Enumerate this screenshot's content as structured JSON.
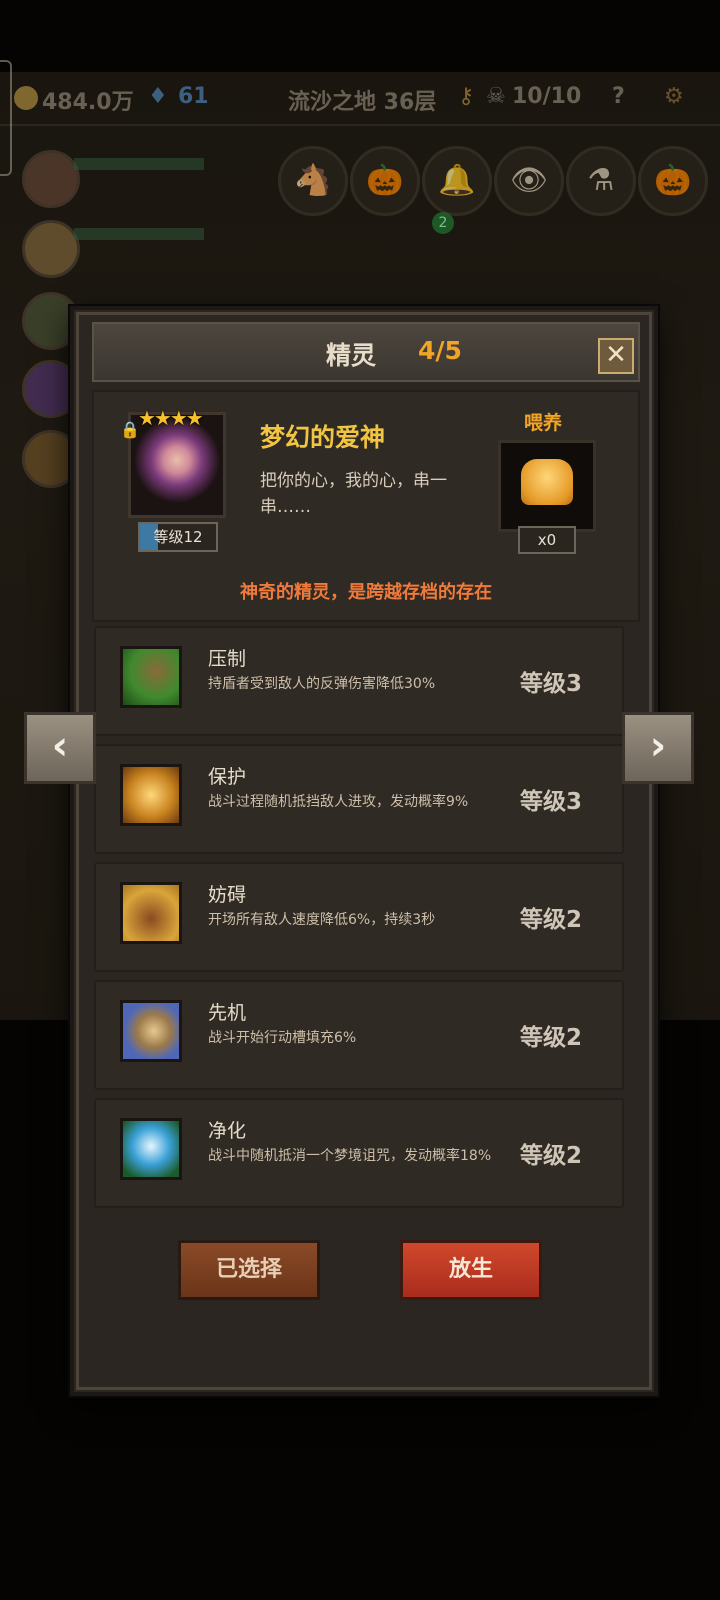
{
  "top_bar": {
    "gold": "484.0万",
    "gems": "61",
    "location": "流沙之地 36层",
    "skulls": "10/10",
    "help_icon": "?"
  },
  "background_icons": [
    "horse-icon",
    "pumpkin-icon",
    "bell-icon",
    "eye-icon",
    "potion-icon",
    "pumpkin-icon"
  ],
  "background_badge": "2",
  "dialog": {
    "title": "精灵",
    "count": "4/5",
    "close_label": "✕"
  },
  "pet": {
    "stars": "★★★★",
    "level_label": "等级12",
    "name": "梦幻的爱神",
    "description": "把你的心，我的心，串一串……",
    "feed_label": "喂养",
    "feed_count": "x0",
    "tagline": "神奇的精灵，是跨越存档的存在",
    "locked": true
  },
  "skills": [
    {
      "name": "压制",
      "desc": "持盾者受到敌人的反弹伤害降低30%",
      "level": "等级3",
      "icon": "claw-icon",
      "color": "#3f8a2e"
    },
    {
      "name": "保护",
      "desc": "战斗过程随机抵挡敌人进攻，发动概率9%",
      "level": "等级3",
      "icon": "shield-spirit-icon",
      "color": "#c98420"
    },
    {
      "name": "妨碍",
      "desc": "开场所有敌人速度降低6%，持续3秒",
      "level": "等级2",
      "icon": "chained-boot-icon",
      "color": "#d9a53a"
    },
    {
      "name": "先机",
      "desc": "战斗开始行动槽填充6%",
      "level": "等级2",
      "icon": "leopard-icon",
      "color": "#5067b8"
    },
    {
      "name": "净化",
      "desc": "战斗中随机抵消一个梦境诅咒，发动概率18%",
      "level": "等级2",
      "icon": "flower-icon",
      "color": "#39a0d6"
    }
  ],
  "buttons": {
    "selected": "已选择",
    "release": "放生"
  },
  "nav": {
    "prev": "‹",
    "next": "›"
  }
}
